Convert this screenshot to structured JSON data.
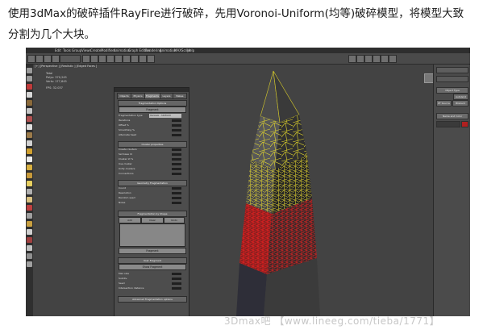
{
  "caption": {
    "line1": "使用3dMax的破碎插件RayFire进行破碎，先用Voronoi-Uniform(均等)破碎模型，将模型大致",
    "line2": "分割为几个大块。"
  },
  "app": {
    "menu": [
      "Edit",
      "Tools",
      "Group",
      "Views",
      "Create",
      "Modifiers",
      "Animation",
      "Graph Editors",
      "Rendering",
      "Animation",
      "MAXScript",
      "Help"
    ],
    "viewport_label": "[+] [Perspective ] [Realistic ] [Edged Faces ]",
    "stats": [
      "Total",
      "Polys: 370,245",
      "Verts: 177,645",
      "FPS: 32.037"
    ]
  },
  "rayfire": {
    "tabs": [
      "Objects",
      "Physics",
      "Fragments",
      "Layers",
      "Bakes"
    ],
    "fragmentation_options": {
      "title": "Fragmentation Options",
      "button": "Fragment",
      "rows": [
        "Fragmentation type",
        "Iterations",
        "Offset %",
        "Smoothing %",
        "Alternate Seed"
      ],
      "type_value": "Voronoi - Uniform"
    },
    "cluster_section": {
      "title": "Cluster properties",
      "rows": [
        "Create clusters",
        "Set base Id",
        "Cluster Id %",
        "Use cluster",
        "Unify clusters",
        "Connections"
      ]
    },
    "custom_section": {
      "title": "Geometry Fragmentation",
      "rows": [
        "Count",
        "Resolution",
        "Random seed",
        "Noise"
      ]
    },
    "by_shape": {
      "title": "Fragmentation by Shape",
      "buttons": [
        "Add",
        "Clear",
        "Undo"
      ]
    },
    "fragment_button": "Fragment",
    "user_fragment": {
      "title": "User Fragment",
      "button": "Show Fragment",
      "rows": [
        "Max size",
        "Subdiv.",
        "Seed",
        "Intersection distance"
      ]
    },
    "advanced": "Advanced Fragmentation options"
  },
  "right_panel": {
    "buttons": [
      "Object Type",
      "AutoGrid",
      "Blizzard",
      "PF Source",
      "Name and Color"
    ]
  },
  "watermark": "3Dmax吧 【www.lineeg.com/tieba/1771】"
}
